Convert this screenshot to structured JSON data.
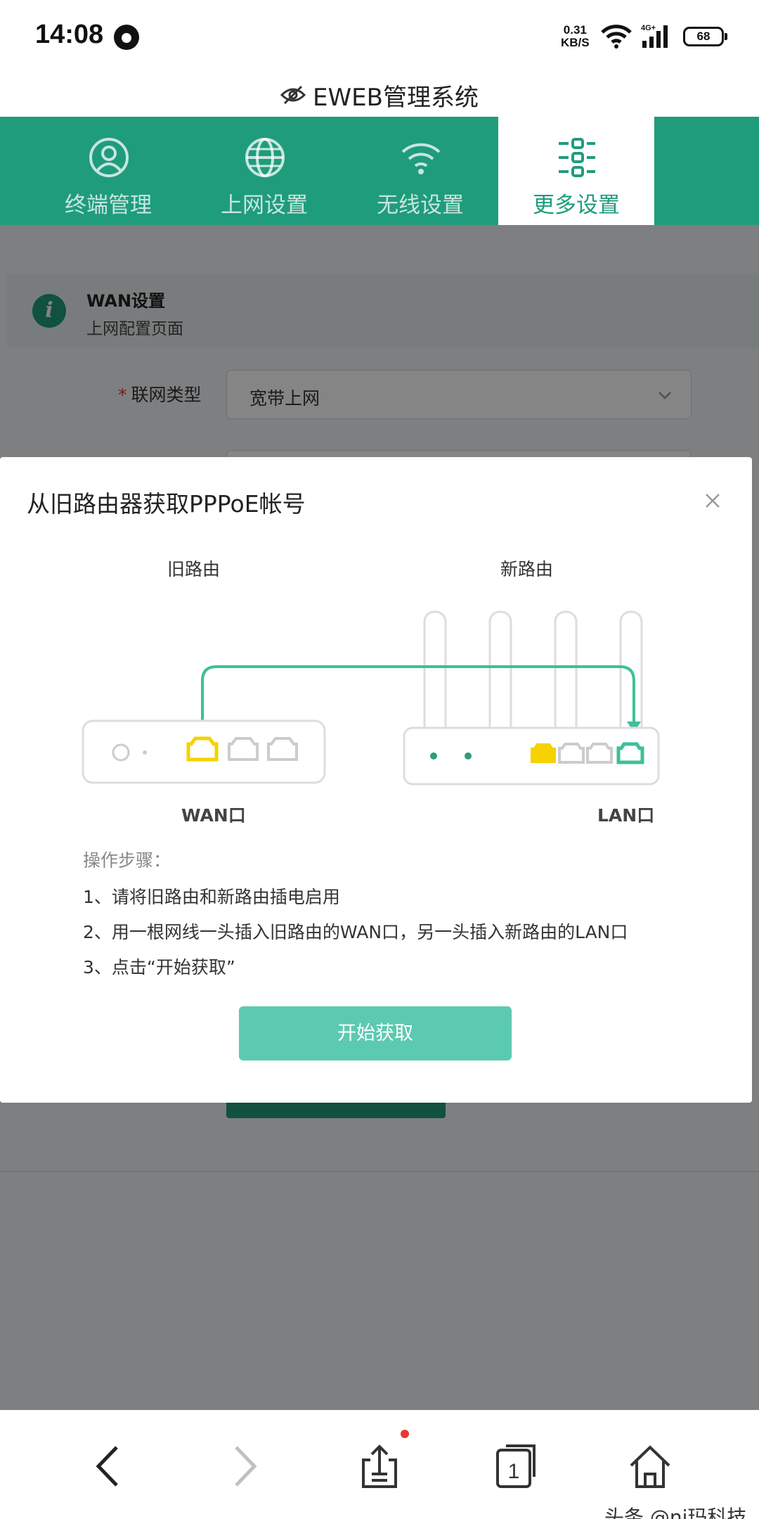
{
  "status_bar": {
    "time": "14:08",
    "speed_value": "0.31",
    "speed_unit": "KB/S",
    "network": "4G+",
    "battery": "68"
  },
  "header": {
    "title": "EWEB管理系统"
  },
  "nav": {
    "tabs": [
      {
        "label": "终端管理",
        "icon": "user-circle-icon"
      },
      {
        "label": "上网设置",
        "icon": "globe-icon"
      },
      {
        "label": "无线设置",
        "icon": "wifi-icon"
      },
      {
        "label": "更多设置",
        "icon": "sliders-icon",
        "active": true
      }
    ]
  },
  "page": {
    "info_title": "WAN设置",
    "info_subtitle": "上网配置页面",
    "form": {
      "required_mark": "*",
      "connection_type_label": "联网类型",
      "connection_type_value": "宽带上网"
    }
  },
  "modal": {
    "title": "从旧路由器获取PPPoE帐号",
    "old_router_label": "旧路由",
    "new_router_label": "新路由",
    "wan_port_label": "WAN口",
    "lan_port_label": "LAN口",
    "steps_title": "操作步骤：",
    "steps": [
      "1、请将旧路由和新路由插电启用",
      "2、用一根网线一头插入旧路由的WAN口，另一头插入新路由的LAN口",
      "3、点击“开始获取”"
    ],
    "start_button": "开始获取"
  },
  "watermark": {
    "text": "头条 @ni玛科技"
  },
  "colors": {
    "brand_green": "#1f9c7c",
    "button_green": "#5ccab0",
    "cable_green": "#3fbf9a",
    "port_yellow": "#f5d200",
    "overlay": "rgba(0,0,0,0.48)"
  }
}
